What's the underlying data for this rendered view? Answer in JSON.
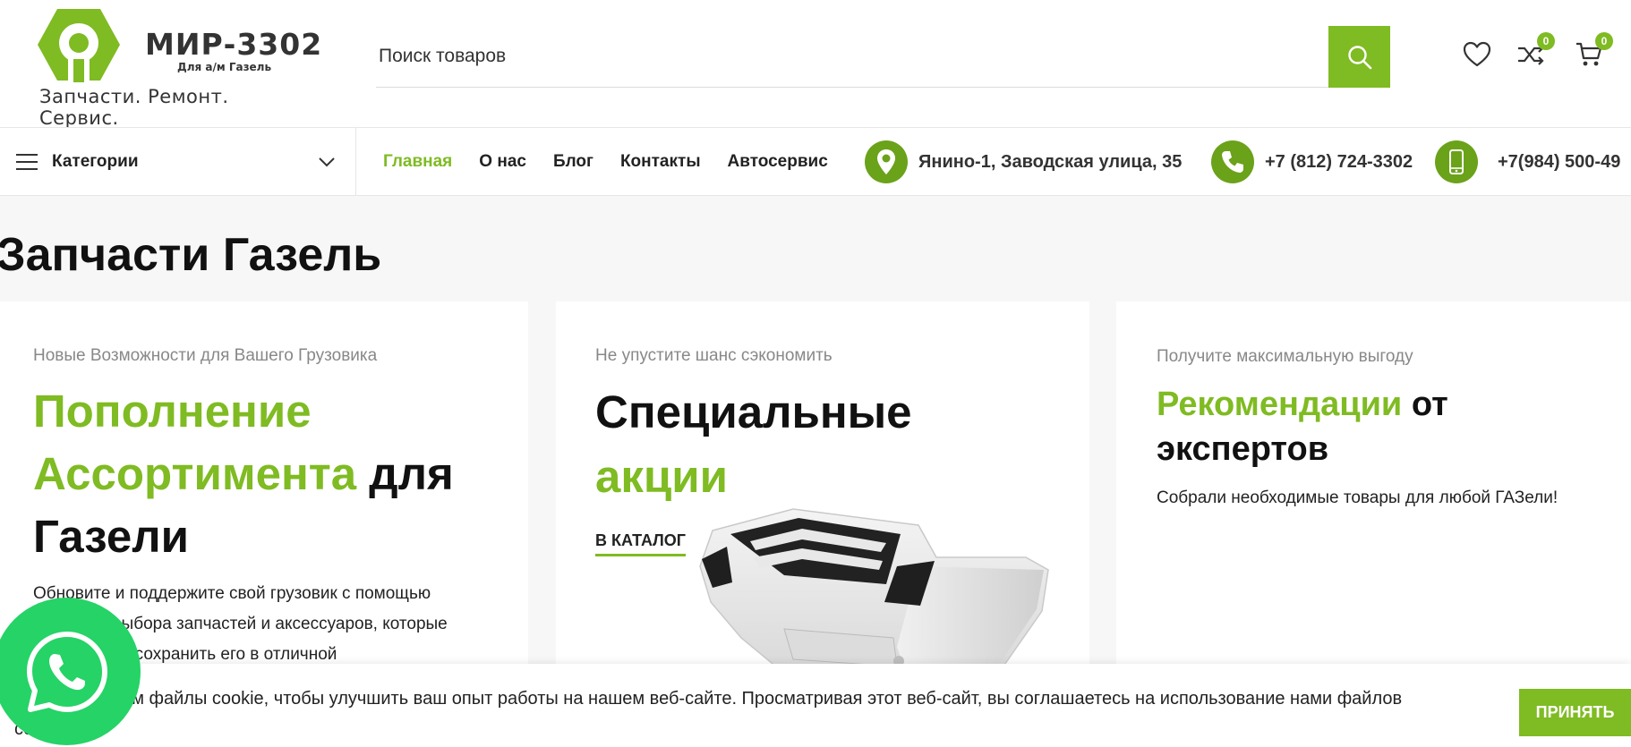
{
  "brand": {
    "name": "МИР-3302",
    "subtitle": "Для а/м Газель",
    "tagline": "Запчасти. Ремонт. Сервис."
  },
  "search": {
    "placeholder": "Поиск товаров"
  },
  "header_icons": {
    "compare_count": "0",
    "cart_count": "0"
  },
  "nav": {
    "categories_label": "Категории",
    "menu": [
      "Главная",
      "О нас",
      "Блог",
      "Контакты",
      "Автосервис"
    ],
    "address": "Янино-1, Заводская улица, 35",
    "phone1": "+7 (812) 724-3302",
    "phone2": "+7(984) 500-49"
  },
  "main": {
    "page_title": "Запчасти Газель"
  },
  "cards": [
    {
      "pretitle": "Новые Возможности для Вашего Грузовика",
      "title_green": "Пополнение Ассортимента",
      "title_dark": "для Газели",
      "text": "Обновите и поддержите свой грузовик с помощью широкого выбора запчастей и аксессуаров, которые помогут вам сохранить его в отличной"
    },
    {
      "pretitle": "Не упустите шанс сэкономить",
      "title_dark": "Специальные",
      "title_green": "акции",
      "link": "В КАТАЛОГ"
    },
    {
      "pretitle": "Получите максимальную выгоду",
      "title_green": "Рекомендации",
      "title_dark": "от экспертов",
      "text": "Собрали необходимые товары для любой ГАЗели!"
    }
  ],
  "cookie": {
    "text": "Мы используем файлы cookie, чтобы улучшить ваш опыт работы на нашем веб-сайте. Просматривая этот веб-сайт, вы соглашаетесь на использование нами файлов cookie.",
    "accept_label": "ПРИНЯТЬ"
  },
  "colors": {
    "accent": "#7fbb22",
    "whatsapp": "#25d366"
  }
}
